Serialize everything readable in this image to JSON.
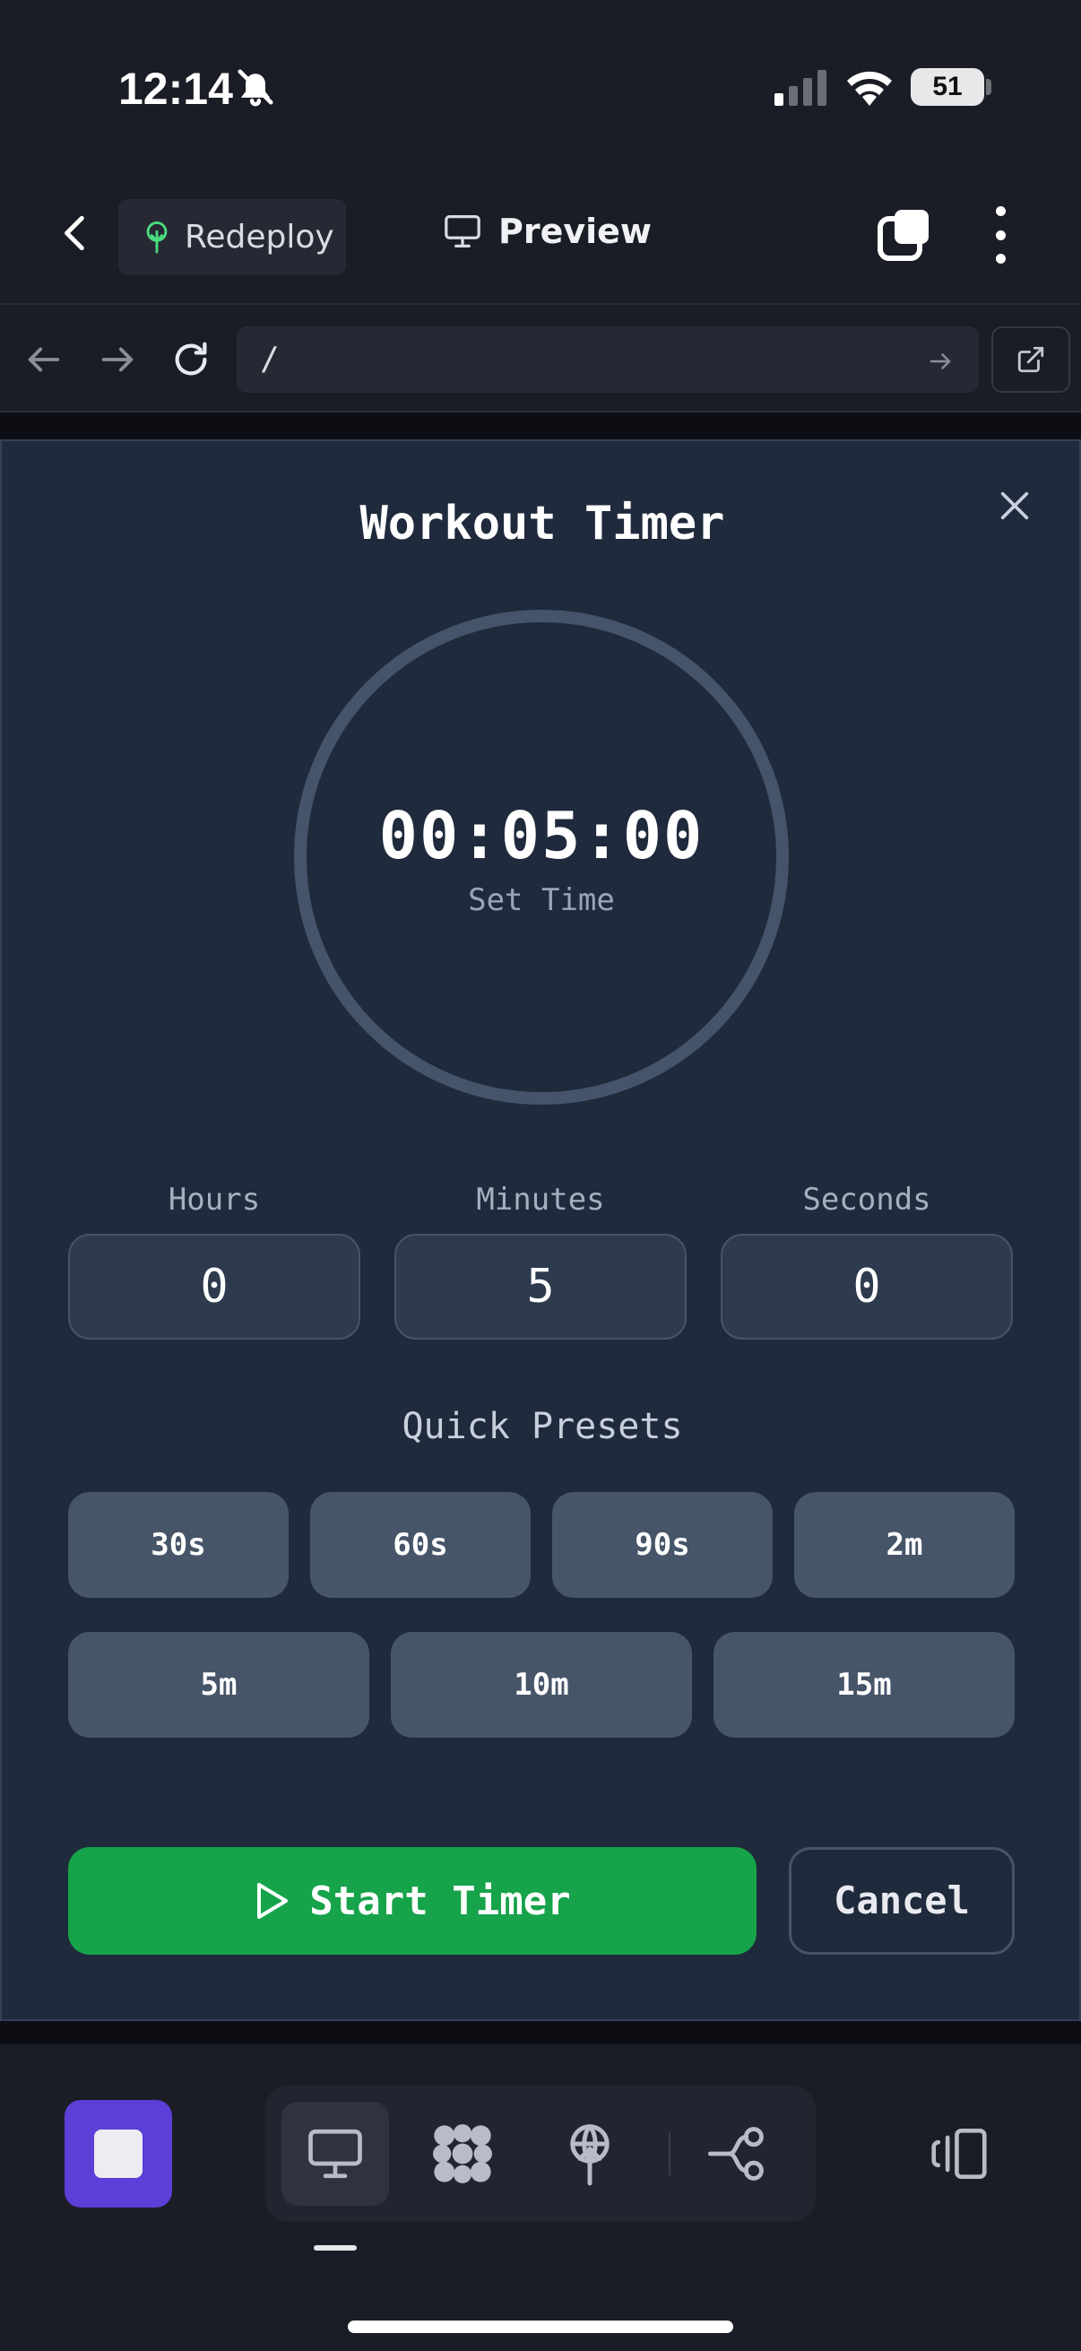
{
  "status_bar": {
    "time": "12:14",
    "battery": "51"
  },
  "header": {
    "redeploy_label": "Redeploy",
    "preview_label": "Preview"
  },
  "url_bar": {
    "url": "/"
  },
  "timer_modal": {
    "title": "Workout Timer",
    "display_time": "00:05:00",
    "display_subtitle": "Set Time",
    "fields": [
      {
        "label": "Hours",
        "value": "0"
      },
      {
        "label": "Minutes",
        "value": "5"
      },
      {
        "label": "Seconds",
        "value": "0"
      }
    ],
    "presets_title": "Quick Presets",
    "presets": [
      "30s",
      "60s",
      "90s",
      "2m",
      "5m",
      "10m",
      "15m"
    ],
    "start_label": "Start Timer",
    "cancel_label": "Cancel"
  },
  "colors": {
    "background": "#1b1d26",
    "modal": "#1f2a3c",
    "accent_green": "#16a34a",
    "accent_purple": "#5b3fd6",
    "preset": "#475569"
  },
  "icons": [
    "bell-slash-icon",
    "signal-icon",
    "wifi-icon",
    "battery-icon",
    "chevron-left-icon",
    "tree-icon",
    "monitor-icon",
    "copy-icon",
    "more-vertical-icon",
    "arrow-left-icon",
    "arrow-right-icon",
    "refresh-icon",
    "external-link-icon",
    "close-icon",
    "play-icon",
    "stop-icon",
    "grid-icon",
    "antenna-icon",
    "flow-icon",
    "devices-icon"
  ]
}
